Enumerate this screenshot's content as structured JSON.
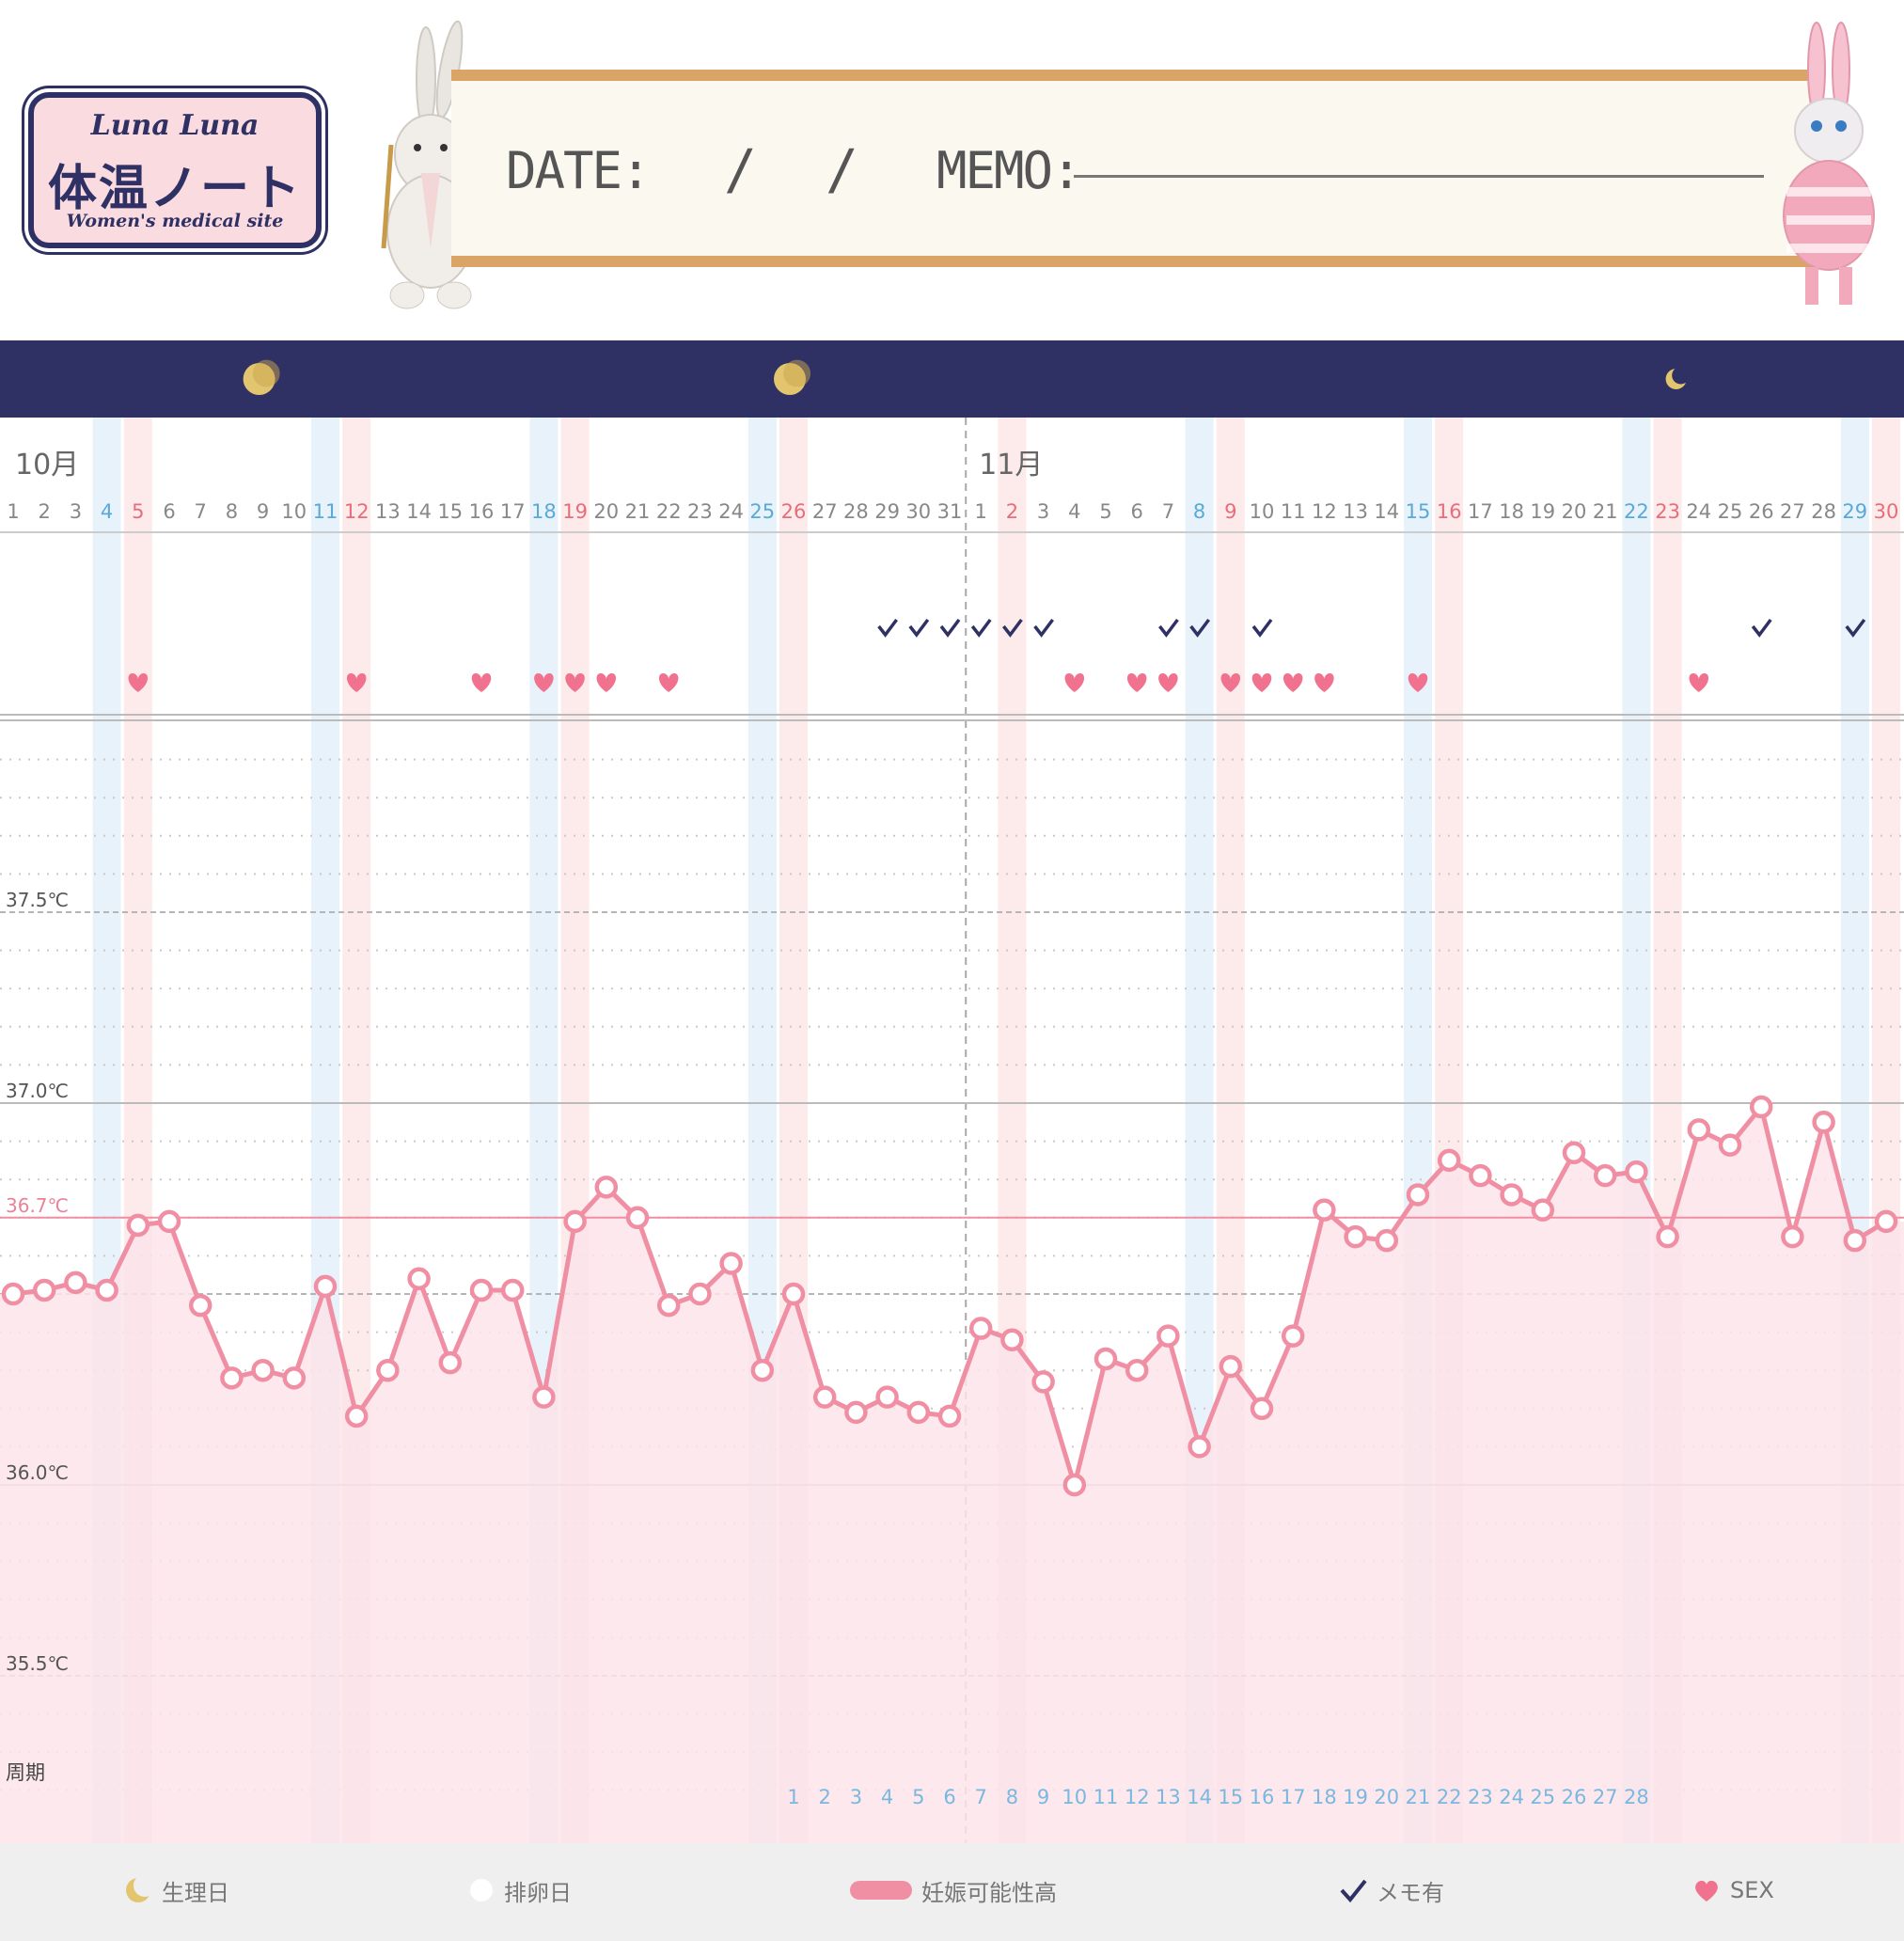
{
  "logo": {
    "brand": "Luna Luna",
    "title": "体温ノート",
    "subtitle": "Women's medical site"
  },
  "board": {
    "date_label": "DATE:",
    "date_sep1": "/",
    "date_sep2": "/",
    "memo_label": "MEMO:"
  },
  "colors": {
    "navy": "#2f3063",
    "pink_line": "#f08fa3",
    "pink_fill": "#fbe4ea",
    "sat_blue": "#5aa9d6",
    "sun_red": "#e76d7c",
    "gray_text": "#888888",
    "moon": "#e3c56f"
  },
  "legend": [
    {
      "icon": "moon-icon",
      "label": "生理日"
    },
    {
      "icon": "white-circle-icon",
      "label": "排卵日"
    },
    {
      "icon": "pink-bar-icon",
      "label": "妊娠可能性高"
    },
    {
      "icon": "check-icon",
      "label": "メモ有"
    },
    {
      "icon": "heart-icon",
      "label": "SEX"
    }
  ],
  "chart_data": {
    "type": "line",
    "months": [
      "10月",
      "11月"
    ],
    "x": [
      "1",
      "2",
      "3",
      "4",
      "5",
      "6",
      "7",
      "8",
      "9",
      "10",
      "11",
      "12",
      "13",
      "14",
      "15",
      "16",
      "17",
      "18",
      "19",
      "20",
      "21",
      "22",
      "23",
      "24",
      "25",
      "26",
      "27",
      "28",
      "29",
      "30",
      "31",
      "1",
      "2",
      "3",
      "4",
      "5",
      "6",
      "7",
      "8",
      "9",
      "10",
      "11",
      "12",
      "13",
      "14",
      "15",
      "16",
      "17",
      "18",
      "19",
      "20",
      "21",
      "22",
      "23",
      "24",
      "25",
      "26",
      "27",
      "28",
      "29",
      "30"
    ],
    "saturday_indices": [
      3,
      10,
      17,
      24,
      38,
      45,
      52,
      59,
      31,
      38
    ],
    "sunday_indices": [
      4,
      11,
      18,
      25,
      32,
      39,
      46,
      53,
      60
    ],
    "y_tick_labels": [
      "37.5℃",
      "37.0℃",
      "36.7℃",
      "36.0℃",
      "35.5℃"
    ],
    "y_ticks": [
      37.5,
      37.0,
      36.7,
      36.0,
      35.5
    ],
    "reference_line": 36.7,
    "ylim": [
      35.05,
      38.1
    ],
    "series": [
      {
        "values": [
          36.5,
          36.51,
          36.53,
          36.51,
          36.68,
          36.69,
          36.47,
          36.28,
          36.3,
          36.28,
          36.52,
          36.18,
          36.3,
          36.54,
          36.32,
          36.51,
          36.51,
          36.23,
          36.69,
          36.78,
          36.7,
          36.47,
          36.5,
          36.58,
          36.3,
          36.5,
          36.23,
          36.19,
          36.23,
          36.19,
          36.18,
          36.41,
          36.38,
          36.27,
          36.0,
          36.33,
          36.3,
          36.39,
          36.1,
          36.31,
          36.2,
          36.39,
          36.72,
          36.65,
          36.64,
          36.76,
          36.85,
          36.81,
          36.76,
          36.72,
          36.87,
          36.81,
          36.82,
          36.65,
          36.93,
          36.89,
          36.99,
          36.65,
          36.95,
          36.64,
          36.69
        ]
      }
    ],
    "memo_days": [
      28,
      29,
      30,
      31,
      32,
      33,
      37,
      38,
      40,
      56,
      59
    ],
    "sex_days": [
      4,
      11,
      15,
      17,
      18,
      19,
      21,
      34,
      36,
      37,
      39,
      40,
      41,
      42,
      45,
      54
    ],
    "cycle_label": "周期",
    "cycle_days": [
      "1",
      "2",
      "3",
      "4",
      "5",
      "6",
      "7",
      "8",
      "9",
      "10",
      "11",
      "12",
      "13",
      "14",
      "15",
      "16",
      "17",
      "18",
      "19",
      "20",
      "21",
      "22",
      "23",
      "24",
      "25",
      "26",
      "27",
      "28"
    ],
    "cycle_start_index": 25,
    "moon_marks": [
      8,
      25,
      53
    ]
  }
}
